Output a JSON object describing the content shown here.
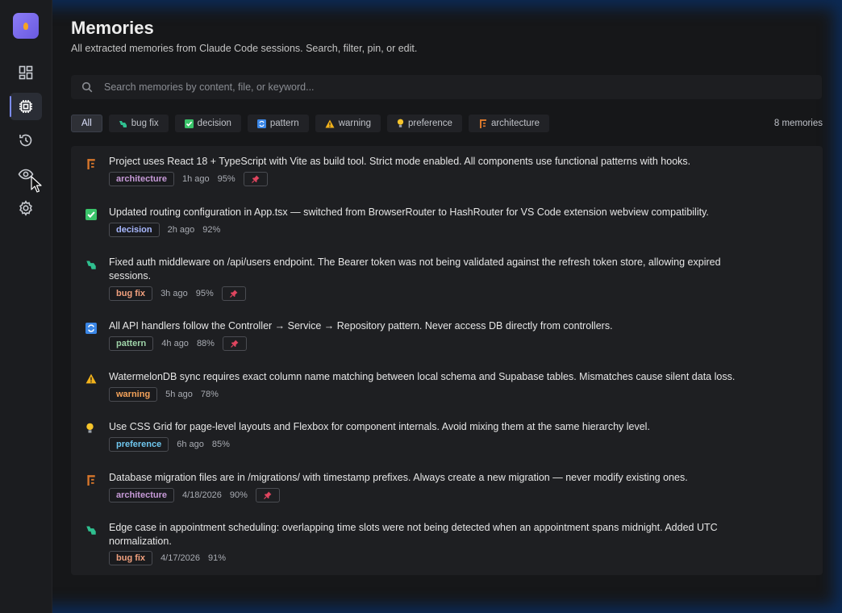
{
  "page": {
    "title": "Memories",
    "subtitle": "All extracted memories from Claude Code sessions. Search, filter, pin, or edit."
  },
  "sidebar": {
    "items": [
      {
        "icon": "dashboard-icon"
      },
      {
        "icon": "chip-icon",
        "active": true
      },
      {
        "icon": "history-icon"
      },
      {
        "icon": "eye-icon"
      },
      {
        "icon": "gear-icon"
      }
    ]
  },
  "search": {
    "placeholder": "Search memories by content, file, or keyword..."
  },
  "filters": {
    "all": "All",
    "bug_fix": "bug fix",
    "decision": "decision",
    "pattern": "pattern",
    "warning": "warning",
    "preference": "preference",
    "architecture": "architecture"
  },
  "count": "8 memories",
  "memories": [
    {
      "text": "Project uses React 18 + TypeScript with Vite as build tool. Strict mode enabled. All components use functional patterns with hooks.",
      "tag": "architecture",
      "time": "1h ago",
      "confidence": "95%",
      "pinned": true
    },
    {
      "text": "Updated routing configuration in App.tsx — switched from BrowserRouter to HashRouter for VS Code extension webview compatibility.",
      "tag": "decision",
      "time": "2h ago",
      "confidence": "92%",
      "pinned": false
    },
    {
      "text": "Fixed auth middleware on /api/users endpoint. The Bearer token was not being validated against the refresh token store, allowing expired sessions.",
      "tag": "bug fix",
      "time": "3h ago",
      "confidence": "95%",
      "pinned": true
    },
    {
      "text": "All API handlers follow the Controller → Service → Repository pattern. Never access DB directly from controllers.",
      "tag": "pattern",
      "time": "4h ago",
      "confidence": "88%",
      "pinned": true
    },
    {
      "text": "WatermelonDB sync requires exact column name matching between local schema and Supabase tables. Mismatches cause silent data loss.",
      "tag": "warning",
      "time": "5h ago",
      "confidence": "78%",
      "pinned": false
    },
    {
      "text": "Use CSS Grid for page-level layouts and Flexbox for component internals. Avoid mixing them at the same hierarchy level.",
      "tag": "preference",
      "time": "6h ago",
      "confidence": "85%",
      "pinned": false
    },
    {
      "text": "Database migration files are in /migrations/ with timestamp prefixes. Always create a new migration — never modify existing ones.",
      "tag": "architecture",
      "time": "4/18/2026",
      "confidence": "90%",
      "pinned": true
    },
    {
      "text": "Edge case in appointment scheduling: overlapping time slots were not being detected when an appointment spans midnight. Added UTC normalization.",
      "tag": "bug fix",
      "time": "4/17/2026",
      "confidence": "91%",
      "pinned": false
    }
  ],
  "colors": {
    "accent": "#7c8cff",
    "background": "#161719",
    "panel": "#1e1f22",
    "pin": "#e0455f"
  }
}
